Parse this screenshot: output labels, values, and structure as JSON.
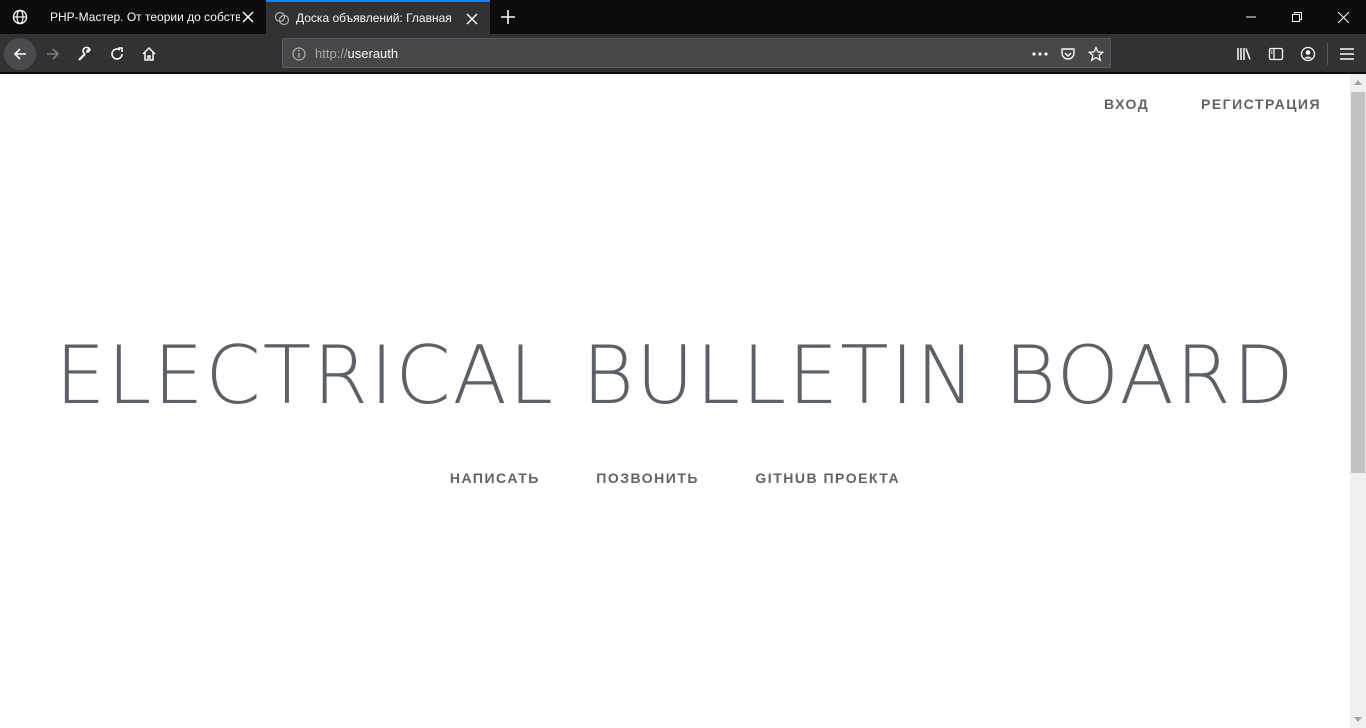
{
  "browser": {
    "tabs": [
      {
        "title": "PHP-Мастер. От теории до собственной CMS",
        "active": false
      },
      {
        "title": "Доска объявлений: Главная",
        "active": true
      }
    ],
    "url": {
      "protocol": "http://",
      "host": "userauth"
    },
    "icons": {
      "tab1": "globe-icon",
      "tab2": "site-favicon",
      "close": "close-icon",
      "newtab": "plus-icon",
      "minimize": "minimize-icon",
      "restore": "restore-icon",
      "window_close": "close-icon",
      "back": "back-arrow-icon",
      "forward": "forward-arrow-icon",
      "tools": "wrench-icon",
      "reload": "reload-icon",
      "home": "home-icon",
      "info": "info-icon",
      "page_actions": "more-dots-icon",
      "pocket": "pocket-icon",
      "bookmark": "star-icon",
      "library": "library-icon",
      "sidebar": "sidebar-icon",
      "account": "account-icon",
      "menu": "hamburger-menu-icon"
    },
    "colors": {
      "accent": "#0a84ff",
      "chrome_dark": "#0c0c0d",
      "toolbar": "#323234"
    }
  },
  "page": {
    "header_nav": {
      "login": "Вход",
      "register": "Регистрация"
    },
    "hero": {
      "title": "ELECTRICAL BULLETIN BOARD",
      "links": [
        "Написать",
        "Позвонить",
        "Github проекта"
      ]
    },
    "colors": {
      "text": "#5f6368",
      "background": "#ffffff"
    }
  }
}
